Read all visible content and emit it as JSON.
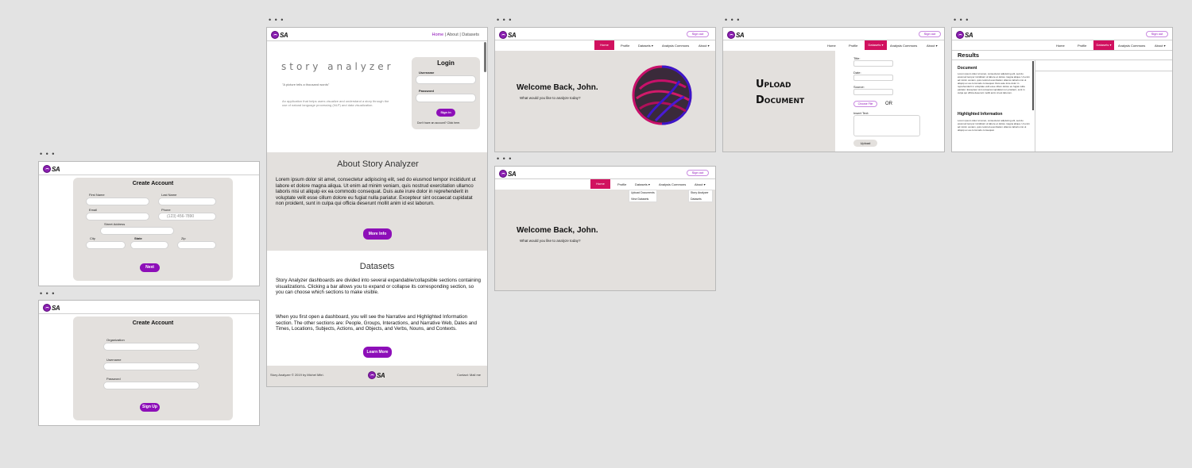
{
  "colors": {
    "purple": "#8d0fb8",
    "pink": "#d1115f",
    "panel": "#e3e0dd",
    "canvas": "#e3e3e3"
  },
  "logo": {
    "text": "SA",
    "icon": "logo-circle-icon"
  },
  "frame_menu": "• • •",
  "create1": {
    "title": "Create Account",
    "first_name": "First Name",
    "last_name": "Last Name",
    "email": "Email",
    "phone": "Phone",
    "phone_placeholder": "(123) 456-7890",
    "street": "Street Address",
    "city": "City",
    "state": "State",
    "zip": "Zip",
    "next": "Next"
  },
  "create2": {
    "title": "Create Account",
    "organization": "Organization",
    "username": "Username",
    "password": "Password",
    "signup": "Sign Up"
  },
  "landing": {
    "nav_home": "Home",
    "nav_sep1": "|",
    "nav_about": "About",
    "nav_sep2": "|",
    "nav_datasets": "Datasets",
    "brand": "story analyzer",
    "quote": "\"A picture tells a thousand words\"",
    "intro": "An application that helps users visualize and understand a story through the use of natural language processing (NLP) and data visualization.",
    "login_title": "Login",
    "username": "Username",
    "password": "Password",
    "signin": "Sign in",
    "no_account": "Don't have an account? Click here.",
    "about_title": "About Story Analyzer",
    "about_text": "Lorem ipsum dolor sit amet, consectetur adipiscing elit, sed do eiusmod tempor incididunt ut labore et dolore magna aliqua. Ut enim ad minim veniam, quis nostrud exercitation ullamco laboris nisi ut aliquip ex ea commodo consequat. Duis aute irure dolor in reprehenderit in voluptate velit esse cillum dolore eu fugiat nulla pariatur. Excepteur sint occaecat cupidatat non proident, sunt in culpa qui officia deserunt mollit anim id est laborum.",
    "more_info": "More Info",
    "datasets_title": "Datasets",
    "datasets_text1": "Story Analyzer dashboards are divided into several expandable/collapsible sections containing visualizations. Clicking a bar allows you to expand or collapse its corresponding section, so you can choose which sections to make visible.",
    "datasets_text2": "When you first open a dashboard, you will see the Narrative and Highlighted Information section. The other sections are: People, Groups, Interactions, and Narrative Web, Dates and Times, Locations, Subjects, Actions, and Objects, and Verbs, Nouns, and Contexts.",
    "learn_more": "Learn More",
    "footer_left": "Story Analyzer © 2019 by Michel Mitri.",
    "footer_right": "Contact: Mail me"
  },
  "nav": {
    "signout": "Sign out",
    "home": "Home",
    "profile": "Profile",
    "datasets": "Datasets ▾",
    "commons": "Analysis Commons",
    "about": "About ▾"
  },
  "welcome": {
    "title": "Welcome Back, John.",
    "subtitle": "What would you like to analyze today?"
  },
  "dropdowns": {
    "datasets_items": [
      "Upload Documents",
      "View Datasets"
    ],
    "about_items": [
      "Story Analyzer",
      "Datasets"
    ]
  },
  "upload": {
    "title_line1": "Upload",
    "title_line2": "Document",
    "title_field": "Title:",
    "date_field": "Date:",
    "source_field": "Source:",
    "choose_file": "Choose File",
    "or": "OR",
    "insert_text": "Insert Text:",
    "upload_btn": "Upload"
  },
  "results": {
    "title": "Results",
    "document": "Document",
    "doc_text": "Lorem ipsum dolor sit amet, consectetur adipiscing elit, sed do eiusmod tempor incididunt ut labore et dolore magna aliqua. Ut enim ad minim veniam, quis nostrud exercitation ullamco laboris nisi ut aliquip ex ea commodo consequat. Duis aute irure dolor in reprehenderit in voluptate velit esse cillum dolore eu fugiat nulla pariatur. Excepteur sint occaecat cupidatat non proident, sunt in culpa qui officia deserunt mollit anim id est laborum.",
    "highlighted": "Highlighted Information",
    "hi_text": "Lorem ipsum dolor sit amet, consectetur adipiscing elit, sed do eiusmod tempor incididunt ut labore et dolore magna aliqua. Ut enim ad minim veniam, quis nostrud exercitation ullamco laboris nisi ut aliquip ex ea commodo consequat."
  }
}
